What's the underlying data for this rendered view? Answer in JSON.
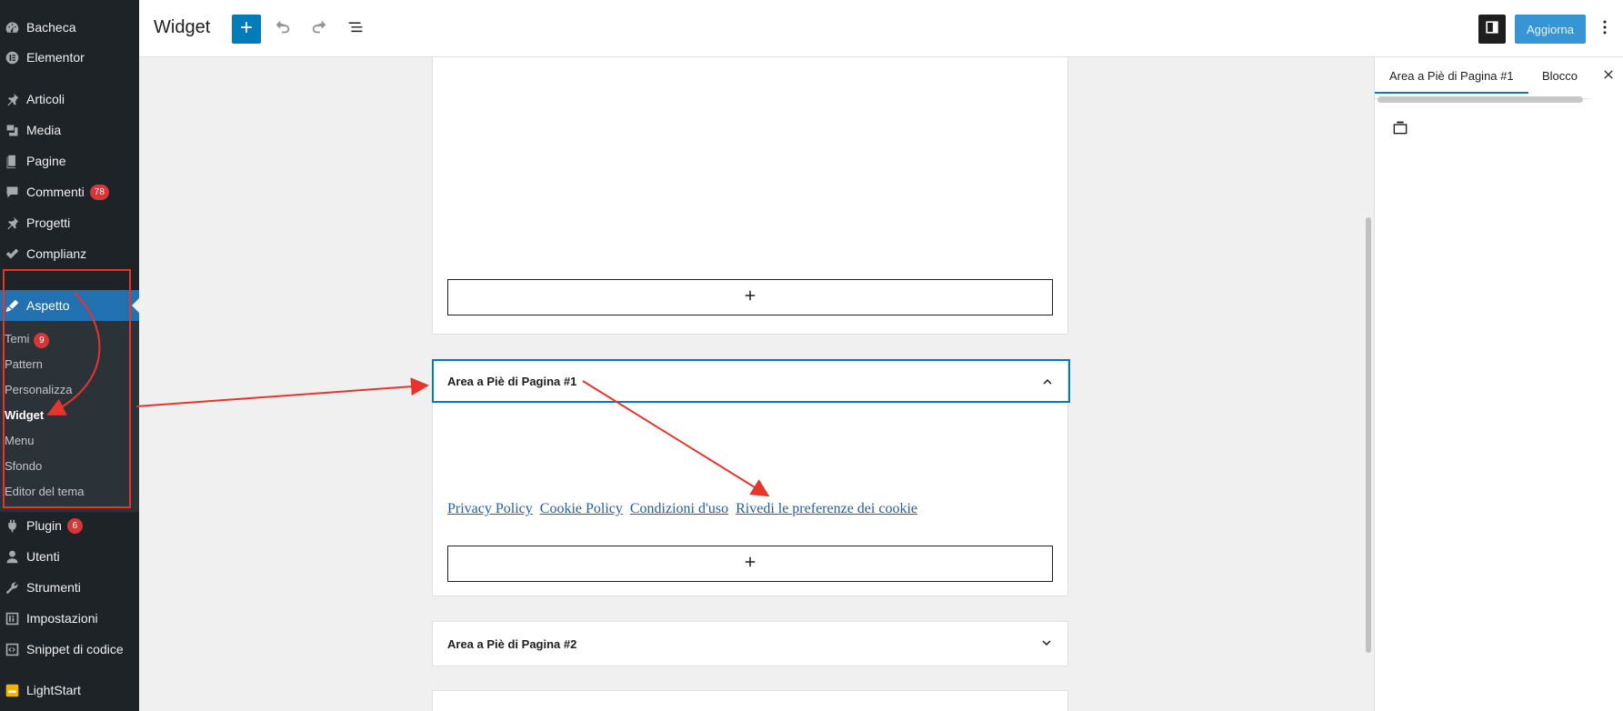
{
  "sidebar": {
    "items": [
      {
        "label": "Bacheca",
        "icon": "dashboard-icon"
      },
      {
        "label": "Elementor",
        "icon": "elementor-icon"
      },
      {
        "label": "Articoli",
        "icon": "pin-icon"
      },
      {
        "label": "Media",
        "icon": "media-icon"
      },
      {
        "label": "Pagine",
        "icon": "pages-icon"
      },
      {
        "label": "Commenti",
        "icon": "comments-icon",
        "badge": "78"
      },
      {
        "label": "Progetti",
        "icon": "pin-icon"
      },
      {
        "label": "Complianz",
        "icon": "check-icon"
      },
      {
        "label": "Aspetto",
        "icon": "appearance-icon"
      },
      {
        "label": "Plugin",
        "icon": "plugin-icon",
        "badge": "6"
      },
      {
        "label": "Utenti",
        "icon": "users-icon"
      },
      {
        "label": "Strumenti",
        "icon": "tools-icon"
      },
      {
        "label": "Impostazioni",
        "icon": "settings-icon"
      },
      {
        "label": "Snippet di codice",
        "icon": "code-icon"
      },
      {
        "label": "LightStart",
        "icon": "lightstart-icon"
      }
    ],
    "submenu": [
      {
        "label": "Temi",
        "badge": "9"
      },
      {
        "label": "Pattern"
      },
      {
        "label": "Personalizza"
      },
      {
        "label": "Widget"
      },
      {
        "label": "Menu"
      },
      {
        "label": "Sfondo"
      },
      {
        "label": "Editor del tema"
      }
    ]
  },
  "header": {
    "title": "Widget",
    "update_label": "Aggiorna"
  },
  "editor": {
    "active_area_title": "Area a Piè di Pagina #1",
    "links": [
      "Privacy Policy",
      "Cookie Policy",
      "Condizioni d'uso",
      "Rivedi le preferenze dei cookie"
    ],
    "second_area_title": "Area a Piè di Pagina #2",
    "inserter_symbol": "+"
  },
  "inspector": {
    "tab_area": "Area a Piè di Pagina #1",
    "tab_block": "Blocco"
  },
  "colors": {
    "admin_sidebar": "#1e2327",
    "accent": "#2271b1",
    "editor_blue": "#007cba",
    "annotation_red": "#e8342c",
    "badge_red": "#d63638"
  }
}
